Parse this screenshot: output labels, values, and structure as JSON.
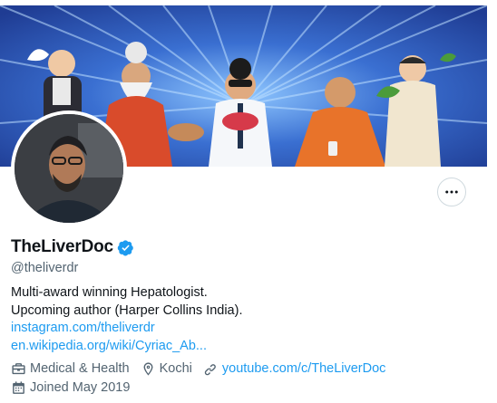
{
  "profile": {
    "name": "TheLiverDoc",
    "handle": "@theliverdr",
    "bio_lines": [
      "Multi-award winning Hepatologist.",
      "Upcoming author (Harper Collins India)."
    ],
    "links": [
      "instagram.com/theliverdr",
      "en.wikipedia.org/wiki/Cyriac_Ab..."
    ],
    "category": "Medical & Health",
    "location": "Kochi",
    "website": "youtube.com/c/TheLiverDoc",
    "joined": "Joined May 2019",
    "verified": true
  },
  "icons": {
    "more": "more-icon",
    "verified": "verified-badge-icon",
    "category": "briefcase-icon",
    "location": "location-pin-icon",
    "website": "link-icon",
    "joined": "calendar-icon"
  },
  "colors": {
    "accent": "#1d9bf0",
    "secondary_text": "#536471",
    "banner_blue": "#2a4fb3"
  }
}
